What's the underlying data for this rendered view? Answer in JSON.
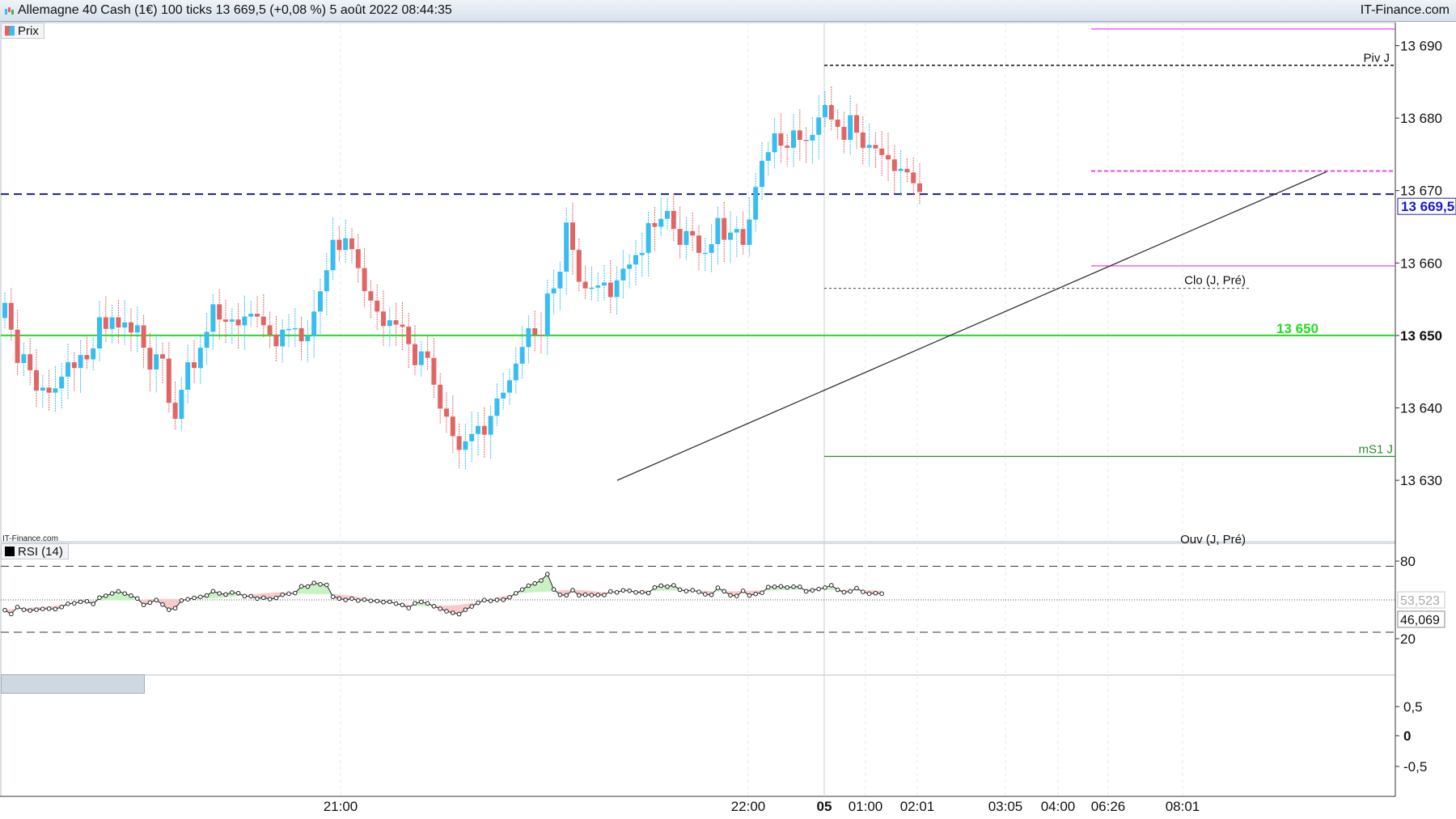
{
  "header": {
    "title": "Allemagne 40 Cash (1€) 100 ticks 13 669,5 (+0,08 %) 5 août 2022 08:44:35",
    "brand": "IT-Finance.com"
  },
  "panels": {
    "price_label": "Prix",
    "rsi_label": "RSI (14)",
    "watermark": "IT-Finance.com"
  },
  "colors": {
    "up": "#37bdf0",
    "down": "#e06666",
    "support_line": "#22dd22",
    "last_price_line": "#1a1aa0",
    "pink_levels": "#ee44ee",
    "trendline": "#333333"
  },
  "chart_data": [
    {
      "type": "candlestick",
      "title": "Prix",
      "ylim": [
        13622,
        13694
      ],
      "y_ticks": [
        "13 690",
        "13 680",
        "13 670",
        "13 660",
        "13 650",
        "13 640",
        "13 630"
      ],
      "y_tick_values": [
        13690,
        13680,
        13670,
        13660,
        13650,
        13640,
        13630
      ],
      "x_tick_labels": [
        "21:00",
        "22:00",
        "05",
        "01:00",
        "02:01",
        "03:05",
        "04:00",
        "06:26",
        "08:01"
      ],
      "last_price": {
        "value": 13669.5,
        "label": "13 669,5"
      },
      "series": [
        {
          "values": [
            13654.5,
            13650.8,
            13646.2,
            13647.4,
            13645.2,
            13642.4,
            13642.8,
            13642.1,
            13642.7,
            13644.3,
            13646.3,
            13645.5,
            13647.3,
            13646.7,
            13648.2,
            13652.5,
            13650.9,
            13652.5,
            13651.1,
            13651.8,
            13650.4,
            13651.4,
            13648.3,
            13645.3,
            13647.4,
            13646.8,
            13640.7,
            13638.5,
            13642.5,
            13646.3,
            13645.5,
            13648.3,
            13650.5,
            13654.3,
            13652.2,
            13651.9,
            13652.2,
            13651.4,
            13652.6,
            13653.0,
            13652.6,
            13651.4,
            13650.1,
            13648.5,
            13650.8,
            13650.9,
            13651.0,
            13649.2,
            13649.9,
            13653.3,
            13656.1,
            13659.0,
            13663.2,
            13661.8,
            13663.4,
            13661.9,
            13659.3,
            13656.1,
            13654.8,
            13653.3,
            13651.3,
            13652.1,
            13651.5,
            13651.2,
            13648.8,
            13645.9,
            13647.8,
            13646.9,
            13643.2,
            13639.9,
            13638.8,
            13636.1,
            13634.2,
            13635.4,
            13636.4,
            13637.5,
            13636.3,
            13638.9,
            13641.3,
            13642.1,
            13643.8,
            13646.1,
            13648.4,
            13651.0,
            13650.1,
            13650.0,
            13655.8,
            13656.5,
            13658.8,
            13665.6,
            13661.8,
            13657.4,
            13656.5,
            13656.6,
            13656.9,
            13657.3,
            13655.3,
            13657.6,
            13659.2,
            13659.8,
            13661.1,
            13661.4,
            13665.5,
            13665.0,
            13666.1,
            13667.2,
            13664.7,
            13662.5,
            13664.4,
            13663.8,
            13661.4,
            13661.4,
            13662.6,
            13666.2,
            13663.2,
            13664.2,
            13664.7,
            13662.5,
            13666.0,
            13670.5,
            13674.1,
            13675.3,
            13677.9,
            13676.2,
            13675.9,
            13678.3,
            13677.0,
            13676.9,
            13677.7,
            13680.1,
            13681.8,
            13679.8,
            13678.8,
            13677.0,
            13680.4,
            13678.0,
            13675.9,
            13676.3,
            13675.8,
            13674.9,
            13674.3,
            13672.7,
            13673.0,
            13672.5,
            13671.0,
            13669.8
          ]
        }
      ],
      "levels": [
        {
          "label": "Piv J",
          "value": 13687.3
        },
        {
          "label": "Clo (J, Pré)",
          "value": 13656.5
        },
        {
          "label": "mS1 J",
          "value": 13633.3
        },
        {
          "label": "Ouv (J, Pré)",
          "value": 13621.0
        },
        {
          "label": "13 650",
          "value": 13650.0
        }
      ],
      "pink_levels": [
        13692.3,
        13672.7,
        13659.6
      ],
      "trendline": {
        "from": [
          13630.0
        ],
        "to": [
          13672.6
        ]
      }
    },
    {
      "type": "line",
      "title": "RSI (14)",
      "ylim": [
        10,
        90
      ],
      "y_ticks": [
        "80",
        "20"
      ],
      "y_tick_values": [
        80,
        20
      ],
      "levels": [
        76,
        25
      ],
      "last_values": [
        "53,523",
        "46,069"
      ],
      "lower_axis_ticks": [
        "0,5",
        "0",
        "-0,5"
      ],
      "series": [
        {
          "values": [
            42.1,
            39.1,
            44.5,
            42.4,
            41.8,
            42.4,
            43.0,
            43.2,
            42.9,
            44.5,
            47.0,
            47.4,
            48.5,
            48.9,
            46.8,
            51.8,
            53.2,
            55.0,
            56.6,
            54.9,
            53.3,
            51.1,
            46.1,
            47.9,
            49.9,
            46.4,
            42.4,
            43.6,
            49.5,
            50.5,
            51.6,
            52.3,
            53.4,
            56.7,
            55.0,
            54.2,
            55.7,
            55.2,
            52.9,
            52.8,
            51.0,
            51.7,
            50.6,
            51.5,
            54.0,
            54.8,
            55.3,
            60.5,
            60.3,
            63.1,
            62.0,
            61.6,
            52.4,
            51.1,
            50.0,
            51.0,
            49.5,
            50.2,
            49.3,
            49.1,
            48.3,
            48.6,
            47.1,
            46.1,
            43.7,
            47.4,
            48.5,
            47.3,
            45.1,
            43.2,
            41.2,
            40.0,
            39.0,
            42.4,
            44.9,
            47.7,
            49.8,
            49.3,
            50.0,
            50.1,
            52.0,
            55.1,
            58.0,
            61.0,
            62.7,
            65.0,
            69.9,
            58.1,
            53.9,
            53.6,
            57.5,
            53.6,
            54.0,
            53.7,
            53.8,
            53.8,
            56.5,
            55.8,
            57.4,
            57.1,
            55.8,
            55.9,
            55.3,
            59.6,
            61.0,
            60.3,
            61.3,
            57.9,
            56.8,
            57.5,
            56.2,
            54.4,
            53.9,
            59.4,
            56.7,
            53.6,
            53.0,
            57.0,
            53.4,
            54.6,
            55.5,
            59.9,
            60.1,
            60.4,
            59.6,
            60.2,
            60.1,
            56.6,
            57.4,
            58.4,
            59.5,
            61.3,
            57.8,
            55.9,
            56.6,
            59.1,
            56.2,
            54.8,
            55.2,
            54.8
          ]
        }
      ]
    }
  ]
}
